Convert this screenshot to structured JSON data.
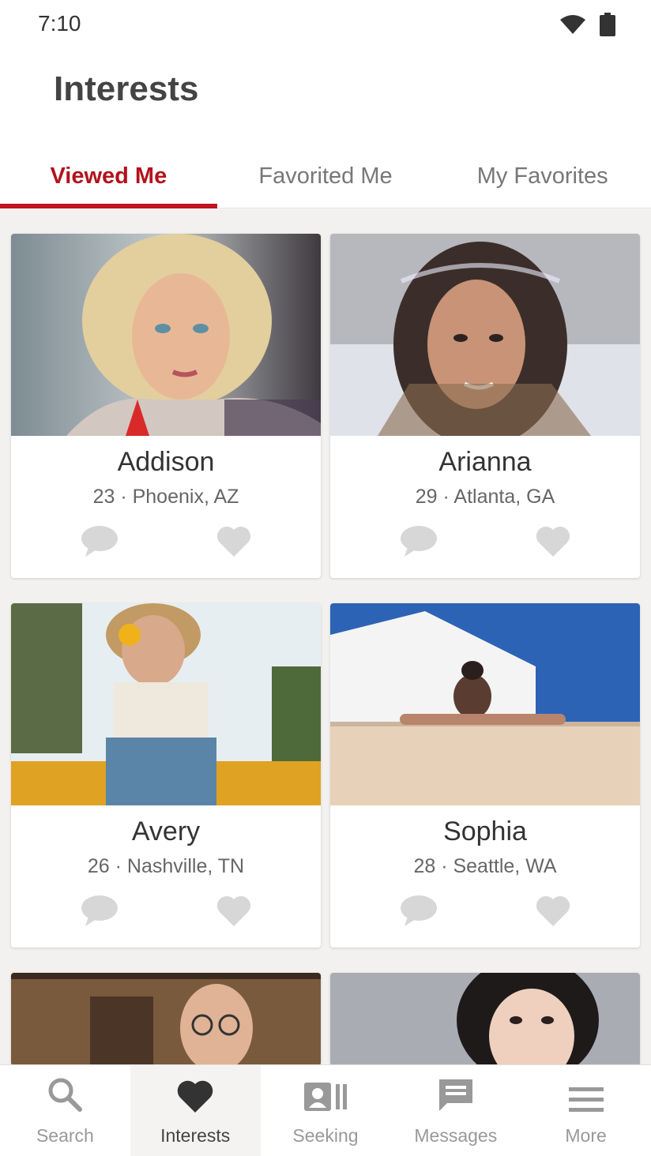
{
  "status": {
    "time": "7:10",
    "icons": [
      "wifi-icon",
      "battery-icon"
    ]
  },
  "header": {
    "title": "Interests"
  },
  "tabs": [
    {
      "label": "Viewed Me",
      "active": true
    },
    {
      "label": "Favorited Me",
      "active": false
    },
    {
      "label": "My Favorites",
      "active": false
    }
  ],
  "profiles": [
    {
      "name": "Addison",
      "meta": "23 · Phoenix, AZ"
    },
    {
      "name": "Arianna",
      "meta": "29 · Atlanta, GA"
    },
    {
      "name": "Avery",
      "meta": "26 · Nashville, TN"
    },
    {
      "name": "Sophia",
      "meta": "28 · Seattle, WA"
    }
  ],
  "bottom_nav": [
    {
      "label": "Search",
      "icon": "search-icon"
    },
    {
      "label": "Interests",
      "icon": "heart-icon",
      "active": true
    },
    {
      "label": "Seeking",
      "icon": "seeking-icon"
    },
    {
      "label": "Messages",
      "icon": "messages-icon"
    },
    {
      "label": "More",
      "icon": "menu-icon"
    }
  ],
  "colors": {
    "accent": "#c0141e",
    "icon_gray": "#d7d7d7",
    "background": "#f2f1f0"
  }
}
